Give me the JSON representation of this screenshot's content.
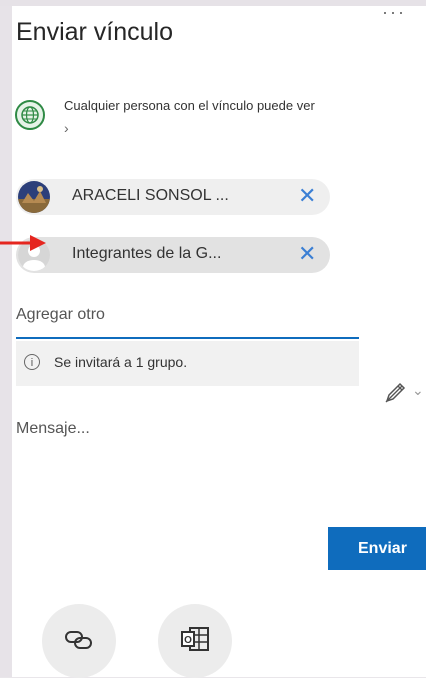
{
  "header": {
    "title": "Enviar vínculo",
    "more_label": "···"
  },
  "permission": {
    "text": "Cualquier persona con el vínculo puede ver",
    "chevron": "›",
    "icon": "globe-icon"
  },
  "recipients": [
    {
      "name": "ARACELI SONSOL ...",
      "remove": "✕",
      "avatar": "photo"
    },
    {
      "name": "Integrantes de la G...",
      "remove": "✕",
      "avatar": "group-placeholder"
    }
  ],
  "add_field": {
    "placeholder": "Agregar otro",
    "info": "Se invitará a 1 grupo."
  },
  "message": {
    "placeholder": "Mensaje..."
  },
  "actions": {
    "send_label": "Enviar"
  },
  "colors": {
    "accent": "#0f6cbd",
    "arrow": "#e5261f",
    "globe": "#2f8a45"
  }
}
